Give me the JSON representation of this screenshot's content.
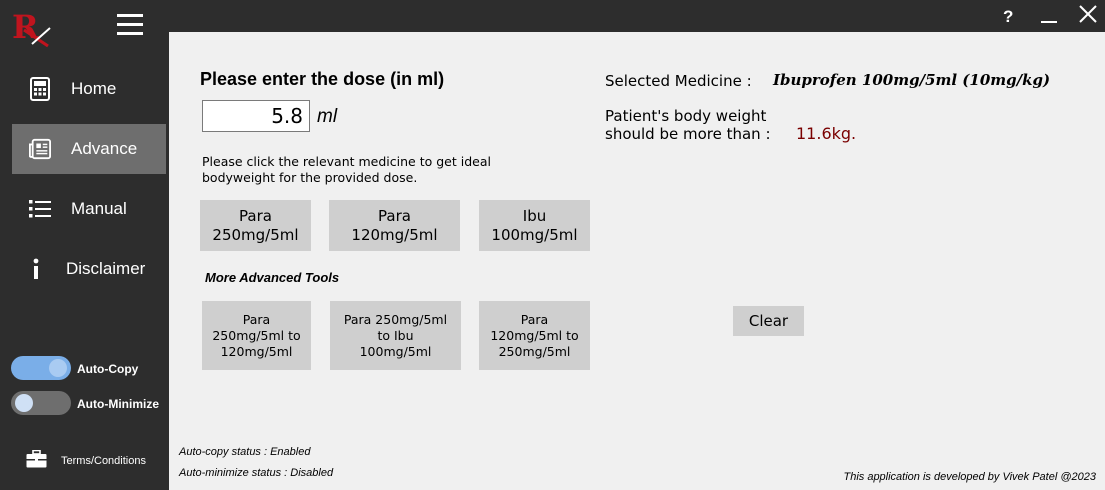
{
  "window": {
    "help_label": "?",
    "minimize_label": "—",
    "close_label": "✕"
  },
  "sidebar": {
    "logo_icon": "rx-logo-icon",
    "menu_icon": "hamburger-menu-icon",
    "items": [
      {
        "label": "Home",
        "icon": "calculator-icon"
      },
      {
        "label": "Advance",
        "icon": "news-icon"
      },
      {
        "label": "Manual",
        "icon": "list-icon"
      },
      {
        "label": "Disclaimer",
        "icon": "info-icon"
      }
    ],
    "toggles": [
      {
        "label": "Auto-Copy",
        "state": "on"
      },
      {
        "label": "Auto-Minimize",
        "state": "off"
      }
    ],
    "terms": {
      "label": "Terms/Conditions",
      "icon": "briefcase-icon"
    }
  },
  "main": {
    "heading": "Please enter the dose (in ml)",
    "dose_value": "5.8",
    "dose_unit": "ml",
    "instruction": "Please click the relevant medicine to get ideal bodyweight for the provided dose.",
    "medicine_buttons": [
      "Para\n250mg/5ml",
      "Para\n120mg/5ml",
      "Ibu\n100mg/5ml"
    ],
    "advanced_title": "More Advanced Tools",
    "advanced_buttons": [
      "Para\n250mg/5ml to\n120mg/5ml",
      "Para 250mg/5ml\nto Ibu\n100mg/5ml",
      "Para\n120mg/5ml to\n250mg/5ml"
    ],
    "selected_label": "Selected Medicine :",
    "selected_value": "Ibuprofen 100mg/5ml (10mg/kg)",
    "weight_line1": "Patient's body weight",
    "weight_line2": "should be more than :",
    "weight_value": "11.6kg.",
    "clear_label": "Clear",
    "status_copy": "Auto-copy status : Enabled",
    "status_minimize": "Auto-minimize status : Disabled",
    "credit": "This application is developed by Vivek Patel @2023"
  },
  "colors": {
    "sidebar_bg": "#2d2d2d",
    "active_item_bg": "#6e6e6e",
    "toggle_on": "#7aaee8",
    "button_bg": "#cfcfcf",
    "weight_value": "#7a0000",
    "logo_red": "#c0141e"
  }
}
